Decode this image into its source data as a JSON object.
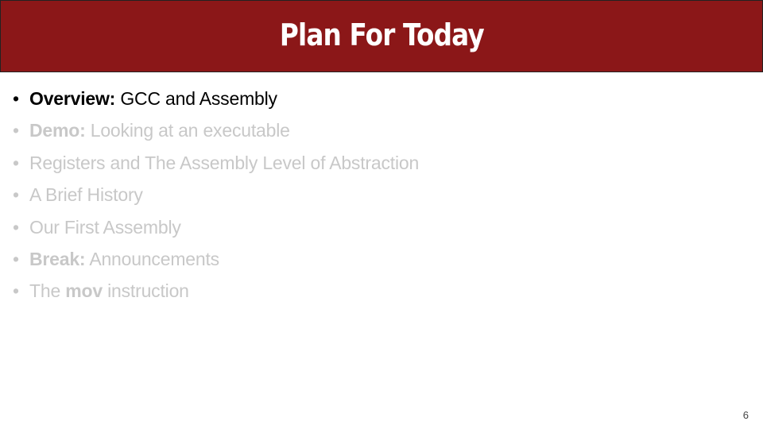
{
  "slide": {
    "title": "Plan For Today",
    "page_number": "6",
    "colors": {
      "header_bg": "#8b1718",
      "title": "#ffffff",
      "active_text": "#000000",
      "dim_text": "#c8c8c8"
    },
    "bullet_glyph": "•",
    "items": [
      {
        "bold": "Overview:",
        "text": " GCC and Assembly",
        "state": "active"
      },
      {
        "bold": "Demo:",
        "text": " Looking at an executable",
        "state": "dim"
      },
      {
        "bold": "",
        "text": "Registers and The Assembly Level of Abstraction",
        "state": "dim"
      },
      {
        "bold": "",
        "text": "A Brief History",
        "state": "dim"
      },
      {
        "bold": "",
        "text": "Our First Assembly",
        "state": "dim"
      },
      {
        "bold": "Break:",
        "text": " Announcements",
        "state": "dim"
      },
      {
        "pre": "The ",
        "bold": "mov",
        "text": " instruction",
        "state": "dim"
      }
    ]
  }
}
